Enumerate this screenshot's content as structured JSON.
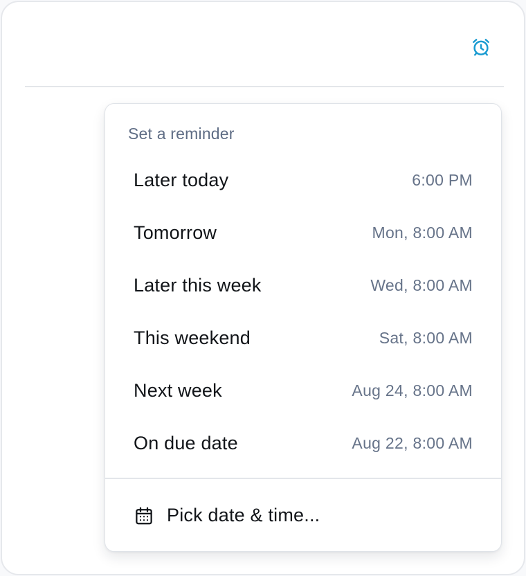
{
  "header": {
    "reminder_icon": "alarm-clock-icon",
    "accent_color": "#1a9bd1"
  },
  "menu": {
    "title": "Set a reminder",
    "options": [
      {
        "label": "Later today",
        "time": "6:00 PM"
      },
      {
        "label": "Tomorrow",
        "time": "Mon, 8:00 AM"
      },
      {
        "label": "Later this week",
        "time": "Wed, 8:00 AM"
      },
      {
        "label": "This weekend",
        "time": "Sat, 8:00 AM"
      },
      {
        "label": "Next week",
        "time": "Aug 24, 8:00 AM"
      },
      {
        "label": "On due date",
        "time": "Aug 22, 8:00 AM"
      }
    ],
    "custom": {
      "icon": "calendar-icon",
      "label": "Pick date & time..."
    }
  }
}
